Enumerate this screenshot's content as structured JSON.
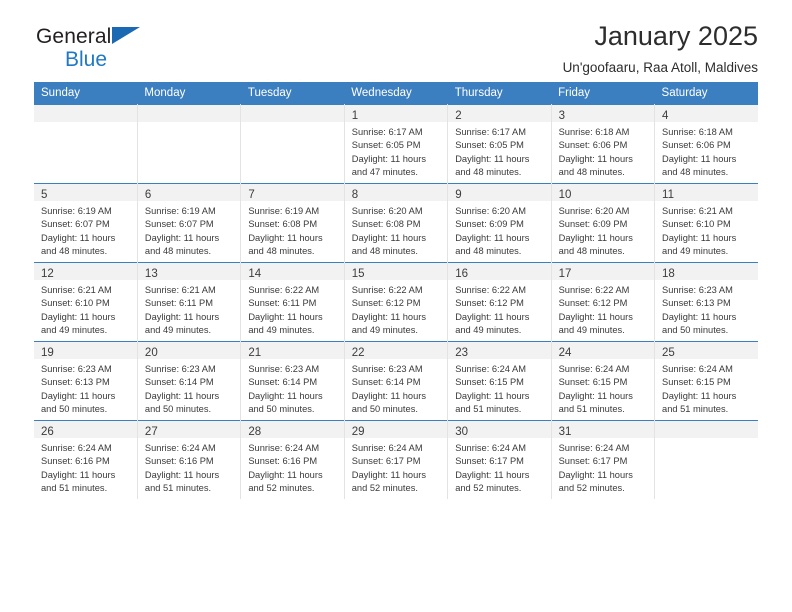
{
  "brand": {
    "name_top": "General",
    "name_bottom": "Blue",
    "triangle_icon": "triangle-icon",
    "accent_color": "#2079c4",
    "triangle_color": "#1b68b3"
  },
  "header": {
    "title": "January 2025",
    "subtitle": "Un'goofaaru, Raa Atoll, Maldives"
  },
  "theme": {
    "header_bg": "#3c7fc1",
    "header_text": "#ffffff",
    "daynum_band_bg": "#f2f2f2",
    "cell_border": "#e3e3e3",
    "week_top_border": "#3c7fc1"
  },
  "weekday_headers": [
    "Sunday",
    "Monday",
    "Tuesday",
    "Wednesday",
    "Thursday",
    "Friday",
    "Saturday"
  ],
  "labels": {
    "sunrise_prefix": "Sunrise:",
    "sunset_prefix": "Sunset:",
    "daylight_prefix": "Daylight:"
  },
  "weeks": [
    [
      {
        "day": "",
        "empty": true,
        "sunrise": "",
        "sunset": "",
        "daylight_line1": "",
        "daylight_line2": ""
      },
      {
        "day": "",
        "empty": true,
        "sunrise": "",
        "sunset": "",
        "daylight_line1": "",
        "daylight_line2": ""
      },
      {
        "day": "",
        "empty": true,
        "sunrise": "",
        "sunset": "",
        "daylight_line1": "",
        "daylight_line2": ""
      },
      {
        "day": "1",
        "empty": false,
        "sunrise": "Sunrise: 6:17 AM",
        "sunset": "Sunset: 6:05 PM",
        "daylight_line1": "Daylight: 11 hours",
        "daylight_line2": "and 47 minutes."
      },
      {
        "day": "2",
        "empty": false,
        "sunrise": "Sunrise: 6:17 AM",
        "sunset": "Sunset: 6:05 PM",
        "daylight_line1": "Daylight: 11 hours",
        "daylight_line2": "and 48 minutes."
      },
      {
        "day": "3",
        "empty": false,
        "sunrise": "Sunrise: 6:18 AM",
        "sunset": "Sunset: 6:06 PM",
        "daylight_line1": "Daylight: 11 hours",
        "daylight_line2": "and 48 minutes."
      },
      {
        "day": "4",
        "empty": false,
        "sunrise": "Sunrise: 6:18 AM",
        "sunset": "Sunset: 6:06 PM",
        "daylight_line1": "Daylight: 11 hours",
        "daylight_line2": "and 48 minutes."
      }
    ],
    [
      {
        "day": "5",
        "empty": false,
        "sunrise": "Sunrise: 6:19 AM",
        "sunset": "Sunset: 6:07 PM",
        "daylight_line1": "Daylight: 11 hours",
        "daylight_line2": "and 48 minutes."
      },
      {
        "day": "6",
        "empty": false,
        "sunrise": "Sunrise: 6:19 AM",
        "sunset": "Sunset: 6:07 PM",
        "daylight_line1": "Daylight: 11 hours",
        "daylight_line2": "and 48 minutes."
      },
      {
        "day": "7",
        "empty": false,
        "sunrise": "Sunrise: 6:19 AM",
        "sunset": "Sunset: 6:08 PM",
        "daylight_line1": "Daylight: 11 hours",
        "daylight_line2": "and 48 minutes."
      },
      {
        "day": "8",
        "empty": false,
        "sunrise": "Sunrise: 6:20 AM",
        "sunset": "Sunset: 6:08 PM",
        "daylight_line1": "Daylight: 11 hours",
        "daylight_line2": "and 48 minutes."
      },
      {
        "day": "9",
        "empty": false,
        "sunrise": "Sunrise: 6:20 AM",
        "sunset": "Sunset: 6:09 PM",
        "daylight_line1": "Daylight: 11 hours",
        "daylight_line2": "and 48 minutes."
      },
      {
        "day": "10",
        "empty": false,
        "sunrise": "Sunrise: 6:20 AM",
        "sunset": "Sunset: 6:09 PM",
        "daylight_line1": "Daylight: 11 hours",
        "daylight_line2": "and 48 minutes."
      },
      {
        "day": "11",
        "empty": false,
        "sunrise": "Sunrise: 6:21 AM",
        "sunset": "Sunset: 6:10 PM",
        "daylight_line1": "Daylight: 11 hours",
        "daylight_line2": "and 49 minutes."
      }
    ],
    [
      {
        "day": "12",
        "empty": false,
        "sunrise": "Sunrise: 6:21 AM",
        "sunset": "Sunset: 6:10 PM",
        "daylight_line1": "Daylight: 11 hours",
        "daylight_line2": "and 49 minutes."
      },
      {
        "day": "13",
        "empty": false,
        "sunrise": "Sunrise: 6:21 AM",
        "sunset": "Sunset: 6:11 PM",
        "daylight_line1": "Daylight: 11 hours",
        "daylight_line2": "and 49 minutes."
      },
      {
        "day": "14",
        "empty": false,
        "sunrise": "Sunrise: 6:22 AM",
        "sunset": "Sunset: 6:11 PM",
        "daylight_line1": "Daylight: 11 hours",
        "daylight_line2": "and 49 minutes."
      },
      {
        "day": "15",
        "empty": false,
        "sunrise": "Sunrise: 6:22 AM",
        "sunset": "Sunset: 6:12 PM",
        "daylight_line1": "Daylight: 11 hours",
        "daylight_line2": "and 49 minutes."
      },
      {
        "day": "16",
        "empty": false,
        "sunrise": "Sunrise: 6:22 AM",
        "sunset": "Sunset: 6:12 PM",
        "daylight_line1": "Daylight: 11 hours",
        "daylight_line2": "and 49 minutes."
      },
      {
        "day": "17",
        "empty": false,
        "sunrise": "Sunrise: 6:22 AM",
        "sunset": "Sunset: 6:12 PM",
        "daylight_line1": "Daylight: 11 hours",
        "daylight_line2": "and 49 minutes."
      },
      {
        "day": "18",
        "empty": false,
        "sunrise": "Sunrise: 6:23 AM",
        "sunset": "Sunset: 6:13 PM",
        "daylight_line1": "Daylight: 11 hours",
        "daylight_line2": "and 50 minutes."
      }
    ],
    [
      {
        "day": "19",
        "empty": false,
        "sunrise": "Sunrise: 6:23 AM",
        "sunset": "Sunset: 6:13 PM",
        "daylight_line1": "Daylight: 11 hours",
        "daylight_line2": "and 50 minutes."
      },
      {
        "day": "20",
        "empty": false,
        "sunrise": "Sunrise: 6:23 AM",
        "sunset": "Sunset: 6:14 PM",
        "daylight_line1": "Daylight: 11 hours",
        "daylight_line2": "and 50 minutes."
      },
      {
        "day": "21",
        "empty": false,
        "sunrise": "Sunrise: 6:23 AM",
        "sunset": "Sunset: 6:14 PM",
        "daylight_line1": "Daylight: 11 hours",
        "daylight_line2": "and 50 minutes."
      },
      {
        "day": "22",
        "empty": false,
        "sunrise": "Sunrise: 6:23 AM",
        "sunset": "Sunset: 6:14 PM",
        "daylight_line1": "Daylight: 11 hours",
        "daylight_line2": "and 50 minutes."
      },
      {
        "day": "23",
        "empty": false,
        "sunrise": "Sunrise: 6:24 AM",
        "sunset": "Sunset: 6:15 PM",
        "daylight_line1": "Daylight: 11 hours",
        "daylight_line2": "and 51 minutes."
      },
      {
        "day": "24",
        "empty": false,
        "sunrise": "Sunrise: 6:24 AM",
        "sunset": "Sunset: 6:15 PM",
        "daylight_line1": "Daylight: 11 hours",
        "daylight_line2": "and 51 minutes."
      },
      {
        "day": "25",
        "empty": false,
        "sunrise": "Sunrise: 6:24 AM",
        "sunset": "Sunset: 6:15 PM",
        "daylight_line1": "Daylight: 11 hours",
        "daylight_line2": "and 51 minutes."
      }
    ],
    [
      {
        "day": "26",
        "empty": false,
        "sunrise": "Sunrise: 6:24 AM",
        "sunset": "Sunset: 6:16 PM",
        "daylight_line1": "Daylight: 11 hours",
        "daylight_line2": "and 51 minutes."
      },
      {
        "day": "27",
        "empty": false,
        "sunrise": "Sunrise: 6:24 AM",
        "sunset": "Sunset: 6:16 PM",
        "daylight_line1": "Daylight: 11 hours",
        "daylight_line2": "and 51 minutes."
      },
      {
        "day": "28",
        "empty": false,
        "sunrise": "Sunrise: 6:24 AM",
        "sunset": "Sunset: 6:16 PM",
        "daylight_line1": "Daylight: 11 hours",
        "daylight_line2": "and 52 minutes."
      },
      {
        "day": "29",
        "empty": false,
        "sunrise": "Sunrise: 6:24 AM",
        "sunset": "Sunset: 6:17 PM",
        "daylight_line1": "Daylight: 11 hours",
        "daylight_line2": "and 52 minutes."
      },
      {
        "day": "30",
        "empty": false,
        "sunrise": "Sunrise: 6:24 AM",
        "sunset": "Sunset: 6:17 PM",
        "daylight_line1": "Daylight: 11 hours",
        "daylight_line2": "and 52 minutes."
      },
      {
        "day": "31",
        "empty": false,
        "sunrise": "Sunrise: 6:24 AM",
        "sunset": "Sunset: 6:17 PM",
        "daylight_line1": "Daylight: 11 hours",
        "daylight_line2": "and 52 minutes."
      },
      {
        "day": "",
        "empty": true,
        "sunrise": "",
        "sunset": "",
        "daylight_line1": "",
        "daylight_line2": ""
      }
    ]
  ]
}
